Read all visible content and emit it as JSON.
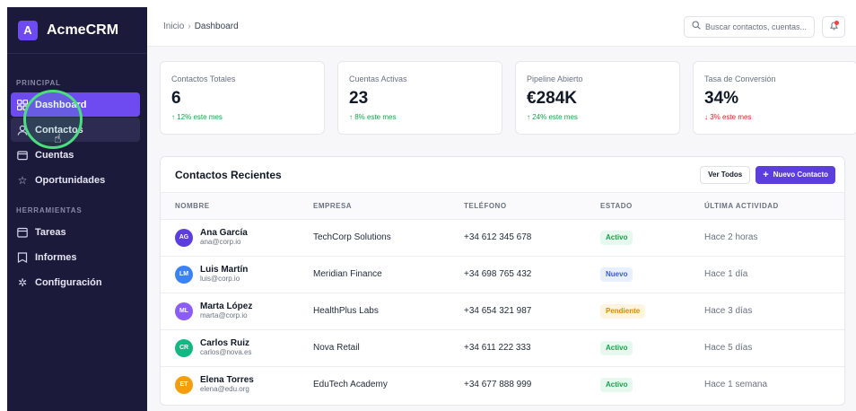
{
  "brand": {
    "logo_letter": "A",
    "name": "AcmeCRM"
  },
  "sidebar": {
    "section_principal": "PRINCIPAL",
    "section_herramientas": "HERRAMIENTAS",
    "principal_items": [
      {
        "label": "Dashboard",
        "icon": "grid-icon",
        "state": "active"
      },
      {
        "label": "Contactos",
        "icon": "user-icon",
        "state": "hover"
      },
      {
        "label": "Cuentas",
        "icon": "folder-icon",
        "state": "normal"
      },
      {
        "label": "Oportunidades",
        "icon": "star-icon",
        "state": "normal"
      }
    ],
    "herramientas_items": [
      {
        "label": "Tareas",
        "icon": "calendar-icon"
      },
      {
        "label": "Informes",
        "icon": "report-icon"
      },
      {
        "label": "Configuración",
        "icon": "gear-icon"
      }
    ]
  },
  "topbar": {
    "breadcrumb_home": "Inicio",
    "breadcrumb_sep": "›",
    "breadcrumb_current": "Dashboard",
    "search_placeholder": "Buscar contactos, cuentas..."
  },
  "stats": [
    {
      "label": "Contactos Totales",
      "value": "6",
      "change": "↑ 12% este mes",
      "trend": "up"
    },
    {
      "label": "Cuentas Activas",
      "value": "23",
      "change": "↑ 8% este mes",
      "trend": "up"
    },
    {
      "label": "Pipeline Abierto",
      "value": "€284K",
      "change": "↑ 24% este mes",
      "trend": "up"
    },
    {
      "label": "Tasa de Conversión",
      "value": "34%",
      "change": "↓ 3% este mes",
      "trend": "down"
    }
  ],
  "recent": {
    "title": "Contactos Recientes",
    "view_all": "Ver Todos",
    "new_contact": "Nuevo Contacto",
    "columns": [
      "NOMBRE",
      "EMPRESA",
      "TELÉFONO",
      "ESTADO",
      "ÚLTIMA ACTIVIDAD"
    ],
    "rows": [
      {
        "initials": "AG",
        "avatar_color": "#5b3de0",
        "name": "Ana García",
        "email": "ana@corp.io",
        "company": "TechCorp Solutions",
        "phone": "+34 612 345 678",
        "status": "Activo",
        "status_kind": "activo",
        "activity": "Hace 2 horas"
      },
      {
        "initials": "LM",
        "avatar_color": "#3b82f6",
        "name": "Luis Martín",
        "email": "luis@corp.io",
        "company": "Meridian Finance",
        "phone": "+34 698 765 432",
        "status": "Nuevo",
        "status_kind": "nuevo",
        "activity": "Hace 1 día"
      },
      {
        "initials": "ML",
        "avatar_color": "#8b5cf6",
        "name": "Marta López",
        "email": "marta@corp.io",
        "company": "HealthPlus Labs",
        "phone": "+34 654 321 987",
        "status": "Pendiente",
        "status_kind": "pendiente",
        "activity": "Hace 3 días"
      },
      {
        "initials": "CR",
        "avatar_color": "#10b981",
        "name": "Carlos Ruiz",
        "email": "carlos@nova.es",
        "company": "Nova Retail",
        "phone": "+34 611 222 333",
        "status": "Activo",
        "status_kind": "activo",
        "activity": "Hace 5 días"
      },
      {
        "initials": "ET",
        "avatar_color": "#f59e0b",
        "name": "Elena Torres",
        "email": "elena@edu.org",
        "company": "EduTech Academy",
        "phone": "+34 677 888 999",
        "status": "Activo",
        "status_kind": "activo",
        "activity": "Hace 1 semana"
      }
    ]
  },
  "colors": {
    "sidebar_bg": "#1c1a3a",
    "accent": "#6d4bf1",
    "primary_button": "#5b3de0",
    "up": "#16a34a",
    "down": "#dc2626",
    "badge_activo_bg": "#e7f8ee",
    "badge_activo_fg": "#16a34a",
    "badge_nuevo_bg": "#e8efff",
    "badge_nuevo_fg": "#3b5bdb",
    "badge_pendiente_bg": "#fff4e0",
    "badge_pendiente_fg": "#e08a00",
    "cursor_highlight": "#4ade80"
  }
}
